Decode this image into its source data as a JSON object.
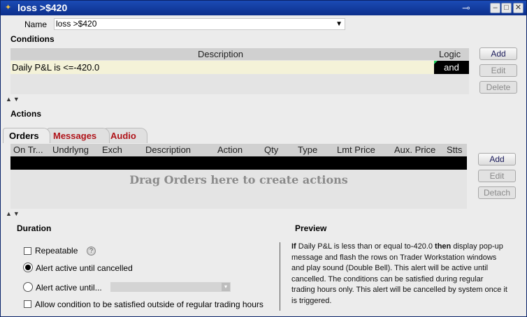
{
  "window": {
    "title": "loss >$420",
    "icons": {
      "app": "bell-icon",
      "pin": "pin-icon",
      "minimize": "minimize-icon",
      "maximize": "maximize-icon",
      "close": "close-icon"
    }
  },
  "name_field": {
    "label": "Name",
    "value": "loss >$420"
  },
  "conditions": {
    "heading": "Conditions",
    "headers": {
      "description": "Description",
      "logic": "Logic"
    },
    "rows": [
      {
        "description": "Daily P&L is <=-420.0",
        "logic": "and"
      }
    ],
    "buttons": {
      "add": "Add",
      "edit": "Edit",
      "delete": "Delete"
    }
  },
  "actions": {
    "heading": "Actions",
    "tabs": [
      {
        "label": "Orders"
      },
      {
        "label": "Messages"
      },
      {
        "label": "Audio"
      }
    ],
    "columns": [
      "On Tr...",
      "Undrlyng",
      "Exch",
      "Description",
      "Action",
      "Qty",
      "Type",
      "Lmt Price",
      "Aux. Price",
      "Stts"
    ],
    "drop_hint": "Drag Orders here to create actions",
    "buttons": {
      "add": "Add",
      "edit": "Edit",
      "detach": "Detach"
    }
  },
  "duration": {
    "heading": "Duration",
    "repeatable": "Repeatable",
    "alert_until_cancelled": "Alert active until cancelled",
    "alert_until": "Alert active until...",
    "allow_outside_rth": "Allow condition to be satisfied outside of regular trading hours",
    "selected": "alert_until_cancelled"
  },
  "preview": {
    "heading": "Preview",
    "if_word": "If",
    "condition_text": " Daily P&L is less than or equal to-420.0 ",
    "then_word": "then",
    "action_text": " display pop-up message and flash the rows on Trader Workstation windows and play sound (Double Bell). This alert will be active until cancelled. The conditions can be satisfied during regular trading hours only. This alert will be cancelled by system once it is triggered."
  },
  "colors": {
    "titlebar": "#0c2f8c",
    "condition_row": "#f4f2d8",
    "tab_red": "#b0141a",
    "logic_flag": "#1ad05a"
  }
}
